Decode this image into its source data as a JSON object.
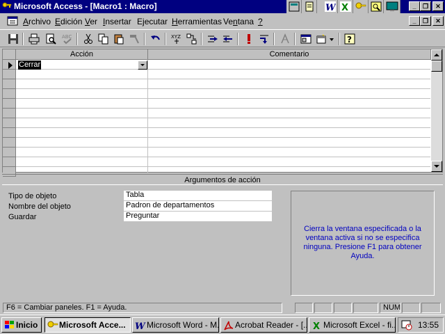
{
  "window": {
    "title": "Microsoft Access - [Macro1 : Macro]"
  },
  "menu": [
    {
      "label": "Archivo",
      "key": "A"
    },
    {
      "label": "Edición",
      "key": "E"
    },
    {
      "label": "Ver",
      "key": "V"
    },
    {
      "label": "Insertar",
      "key": "I"
    },
    {
      "label": "Ejecutar",
      "key": "j"
    },
    {
      "label": "Herramientas",
      "key": "H"
    },
    {
      "label": "Ventana",
      "key": "n"
    },
    {
      "label": "?",
      "key": "?"
    }
  ],
  "grid": {
    "headers": {
      "accion": "Acción",
      "comentario": "Comentario"
    },
    "rows": [
      {
        "accion": "Cerrar",
        "comentario": ""
      }
    ]
  },
  "args": {
    "title": "Argumentos de acción",
    "fields": [
      {
        "label": "Tipo de objeto",
        "value": "Tabla"
      },
      {
        "label": "Nombre del objeto",
        "value": "Padron de departamentos"
      },
      {
        "label": "Guardar",
        "value": "Preguntar"
      }
    ],
    "help": "Cierra la ventana especificada o la ventana activa si no se especifica ninguna. Presione F1 para obtener Ayuda."
  },
  "status": {
    "text": "F6 = Cambiar paneles.  F1 = Ayuda.",
    "num": "NUM"
  },
  "taskbar": {
    "start": "Inicio",
    "tasks": [
      "Microsoft Acce...",
      "Microsoft Word - M...",
      "Acrobat Reader - [...",
      "Microsoft Excel - fi..."
    ],
    "clock": "13:55"
  },
  "colors": {
    "titlebar": "#000080",
    "face": "#c0c0c0",
    "help_text": "#0000c0"
  }
}
